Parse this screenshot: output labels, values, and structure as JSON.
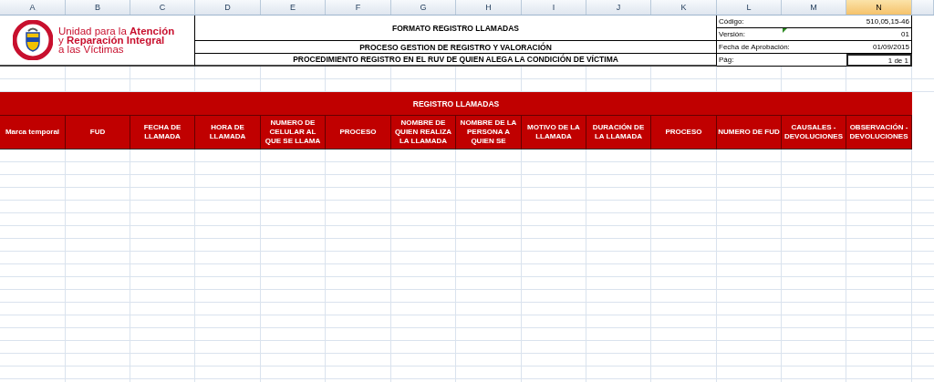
{
  "columns": [
    {
      "label": "A",
      "selected": false
    },
    {
      "label": "B",
      "selected": false
    },
    {
      "label": "C",
      "selected": false
    },
    {
      "label": "D",
      "selected": false
    },
    {
      "label": "E",
      "selected": false
    },
    {
      "label": "F",
      "selected": false
    },
    {
      "label": "G",
      "selected": false
    },
    {
      "label": "H",
      "selected": false
    },
    {
      "label": "I",
      "selected": false
    },
    {
      "label": "J",
      "selected": false
    },
    {
      "label": "K",
      "selected": false
    },
    {
      "label": "L",
      "selected": false
    },
    {
      "label": "M",
      "selected": false
    },
    {
      "label": "N",
      "selected": true
    }
  ],
  "logo": {
    "lines": [
      "Unidad para la **Atención**",
      "y **Reparación Integral**",
      "a las Víctimas"
    ]
  },
  "titles": [
    "FORMATO REGISTRO LLAMADAS",
    "PROCESO GESTION DE REGISTRO Y VALORACIÓN",
    "PROCEDIMIENTO REGISTRO EN EL RUV DE QUIEN ALEGA LA CONDICIÓN DE VÍCTIMA"
  ],
  "info": [
    {
      "label": "Código:",
      "value": "510,05,15-46",
      "selected": false,
      "comment": false
    },
    {
      "label": "Versión:",
      "value": "01",
      "selected": false,
      "comment": true
    },
    {
      "label": "Fecha de Aprobación:",
      "value": "01/09/2015",
      "selected": false,
      "comment": false
    },
    {
      "label": "Pág:",
      "value": "1 de 1",
      "selected": true,
      "comment": false
    }
  ],
  "table": {
    "title": "REGISTRO LLAMADAS",
    "headers": [
      "Marca temporal",
      "FUD",
      "FECHA DE LLAMADA",
      "HORA DE LLAMADA",
      "NUMERO DE CELULAR AL QUE SE LLAMA",
      "PROCESO",
      "NOMBRE DE QUIEN REALIZA LA LLAMADA",
      "NOMBRE DE LA PERSONA A QUIEN SE",
      "MOTIVO DE LA LLAMADA",
      "DURACIÓN DE LA LLAMADA",
      "PROCESO",
      "NUMERO DE FUD",
      "CAUSALES - DEVOLUCIONES",
      "OBSERVACIÓN - DEVOLUCIONES"
    ]
  }
}
